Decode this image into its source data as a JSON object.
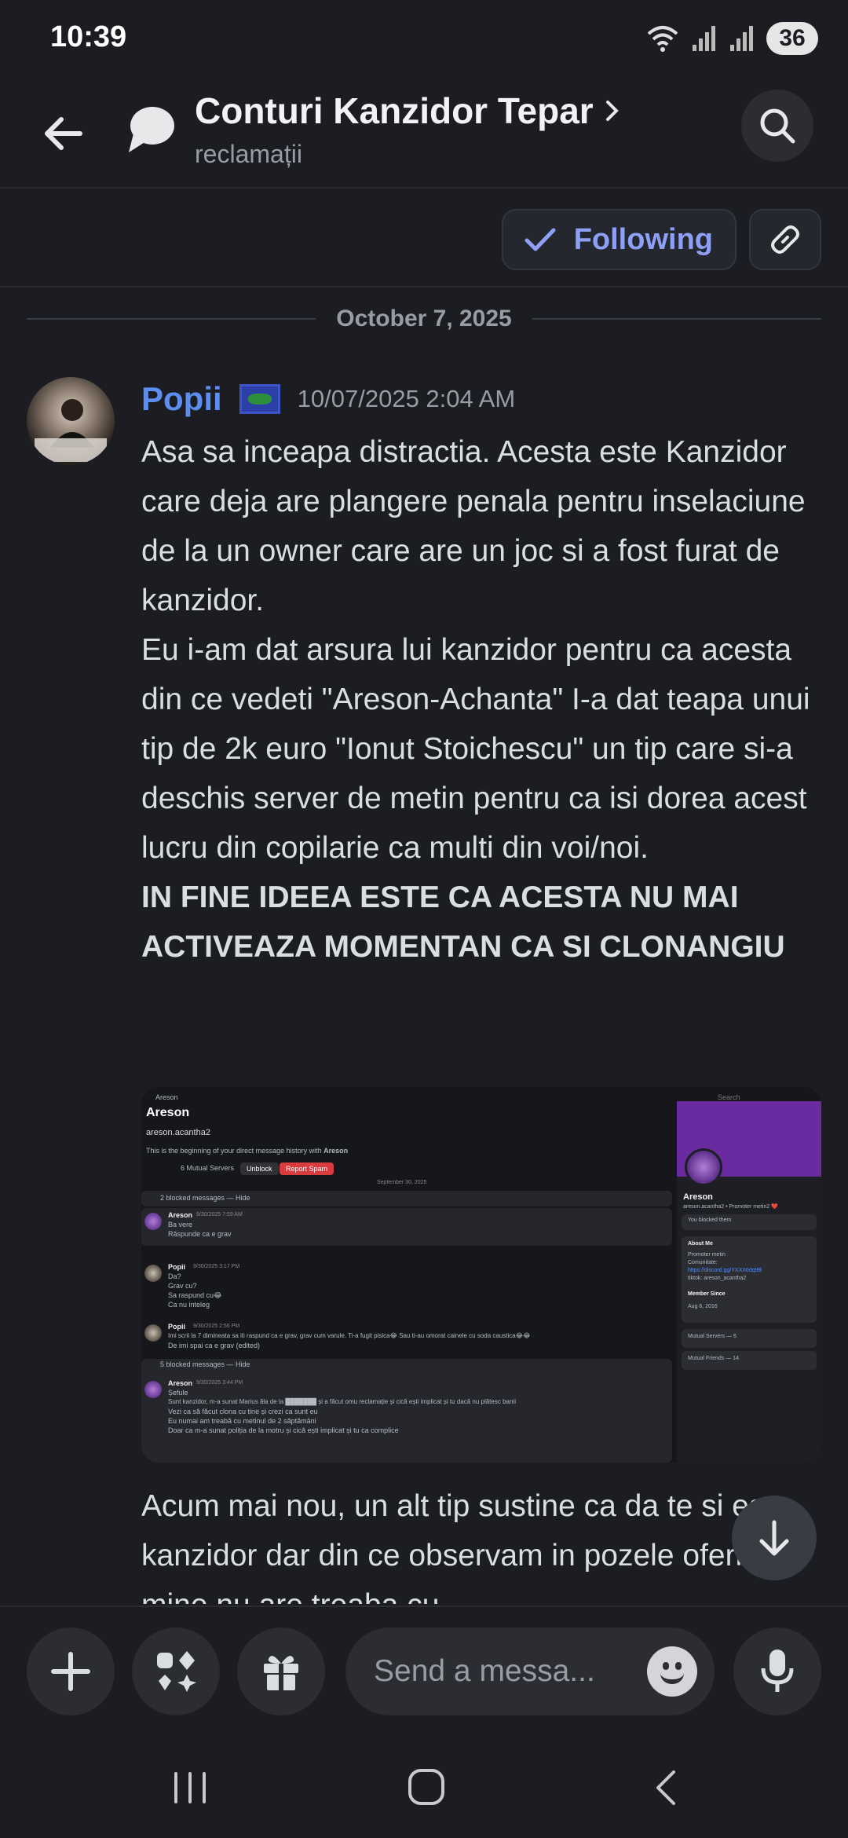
{
  "status": {
    "time": "10:39",
    "battery": "36"
  },
  "header": {
    "title": "Conturi Kanzidor Tepar",
    "channel": "reclamații"
  },
  "actions": {
    "following_label": "Following"
  },
  "divider": {
    "date": "October 7, 2025"
  },
  "message": {
    "author": "Popii",
    "timestamp": "10/07/2025 2:04 AM",
    "paragraphs": [
      "Asa sa inceapa distractia. Acesta este Kanzidor care deja are plangere penala pentru inselaciune de la un owner care are un joc si a fost furat de kanzidor.",
      "Eu i-am dat arsura lui kanzidor pentru ca acesta din ce vedeti \"Areson-Achanta\" I-a dat teapa unui tip de 2k euro \"Ionut Stoichescu\" un tip care si-a deschis server de metin pentru ca isi dorea acest lucru din copilarie ca multi din voi/noi."
    ],
    "bold_text": "IN FINE IDEEA ESTE CA ACESTA NU MAI ACTIVEAZA MOMENTAN CA SI CLONANGIU",
    "followup": "Acum mai nou, un alt tip sustine ca da te si este kanzidor dar din ce observam in pozele oferite de mine nu are treaba cu"
  },
  "attachment": {
    "topbar_name": "Areson",
    "search_placeholder": "Search",
    "profile_name": "Areson",
    "profile_handle": "areson.acantha2",
    "history_note_prefix": "This is the beginning of your direct message history with ",
    "history_note_name": "Areson",
    "mutual_servers_inline": "6 Mutual Servers",
    "unblock_label": "Unblock",
    "report_spam_label": "Report Spam",
    "divider_date": "September 30, 2025",
    "blocked_1": "2 blocked messages — Hide",
    "msg1_author": "Areson",
    "msg1_time": "9/30/2025 7:59 AM",
    "msg1_lines": [
      "Ba vere",
      "Răspunde ca e grav"
    ],
    "msg2_author": "Popii",
    "msg2_time": "9/30/2025 3:17 PM",
    "msg2_lines": [
      "Da?",
      "Grav cu?",
      "Sa raspund cu😂",
      "Ca nu inteleg"
    ],
    "msg3_author": "Popii",
    "msg3_time": "9/30/2025 2:56 PM",
    "msg3_lines": [
      "Imi scrii la 7 dimineata sa iti raspund ca e grav, grav cum varule. Ti-a fugit pisica😂 Sau ti-au omorat cainele cu soda caustica😂😂",
      "De imi spai ca e grav (edited)"
    ],
    "blocked_2": "5 blocked messages — Hide",
    "msg4_author": "Areson",
    "msg4_time": "9/30/2025 3:44 PM",
    "msg4_lines": [
      "Șefule",
      "Sunt kanzidor, m-a sunat Marius ăla de la ███████ și a făcut omu reclamație și cică ești implicat și tu dacă nu plătesc banii",
      "Vezi ca să făcut clona cu tine și crezi ca sunt eu",
      "Eu numai am treabă cu metinul de 2 săptămâni",
      "Doar ca m-a sunat poliția de la motru și cică ești implicat și tu ca complice"
    ],
    "side_name": "Areson",
    "side_handle": "areson.acantha2 • Promoter metin2 ❤️",
    "side_blocked": "You blocked them",
    "side_about_title": "About Me",
    "side_about_lines": [
      "Promoter metin",
      "Comunitate:",
      "https://discord.gg/YXXX6dq9B",
      "tiktok: areson_acantha2"
    ],
    "side_member_title": "Member Since",
    "side_member_date": "Aug 6, 2016",
    "side_mutual_servers": "Mutual Servers — 6",
    "side_mutual_friends": "Mutual Friends — 14"
  },
  "composer": {
    "placeholder": "Send a messa..."
  },
  "icons": {
    "back": "back-arrow-icon",
    "channel": "thread-bubble-icon",
    "chevron": "chevron-right-icon",
    "search": "search-icon",
    "check": "check-icon",
    "link": "link-icon",
    "scroll": "arrow-down-icon",
    "plus": "plus-icon",
    "apps": "apps-icon",
    "gift": "gift-icon",
    "emoji": "emoji-icon",
    "mic": "microphone-icon"
  },
  "colors": {
    "background": "#1c1d22",
    "author": "#5c8ef0",
    "following": "#8e9ff6",
    "danger": "#d83c3e"
  }
}
